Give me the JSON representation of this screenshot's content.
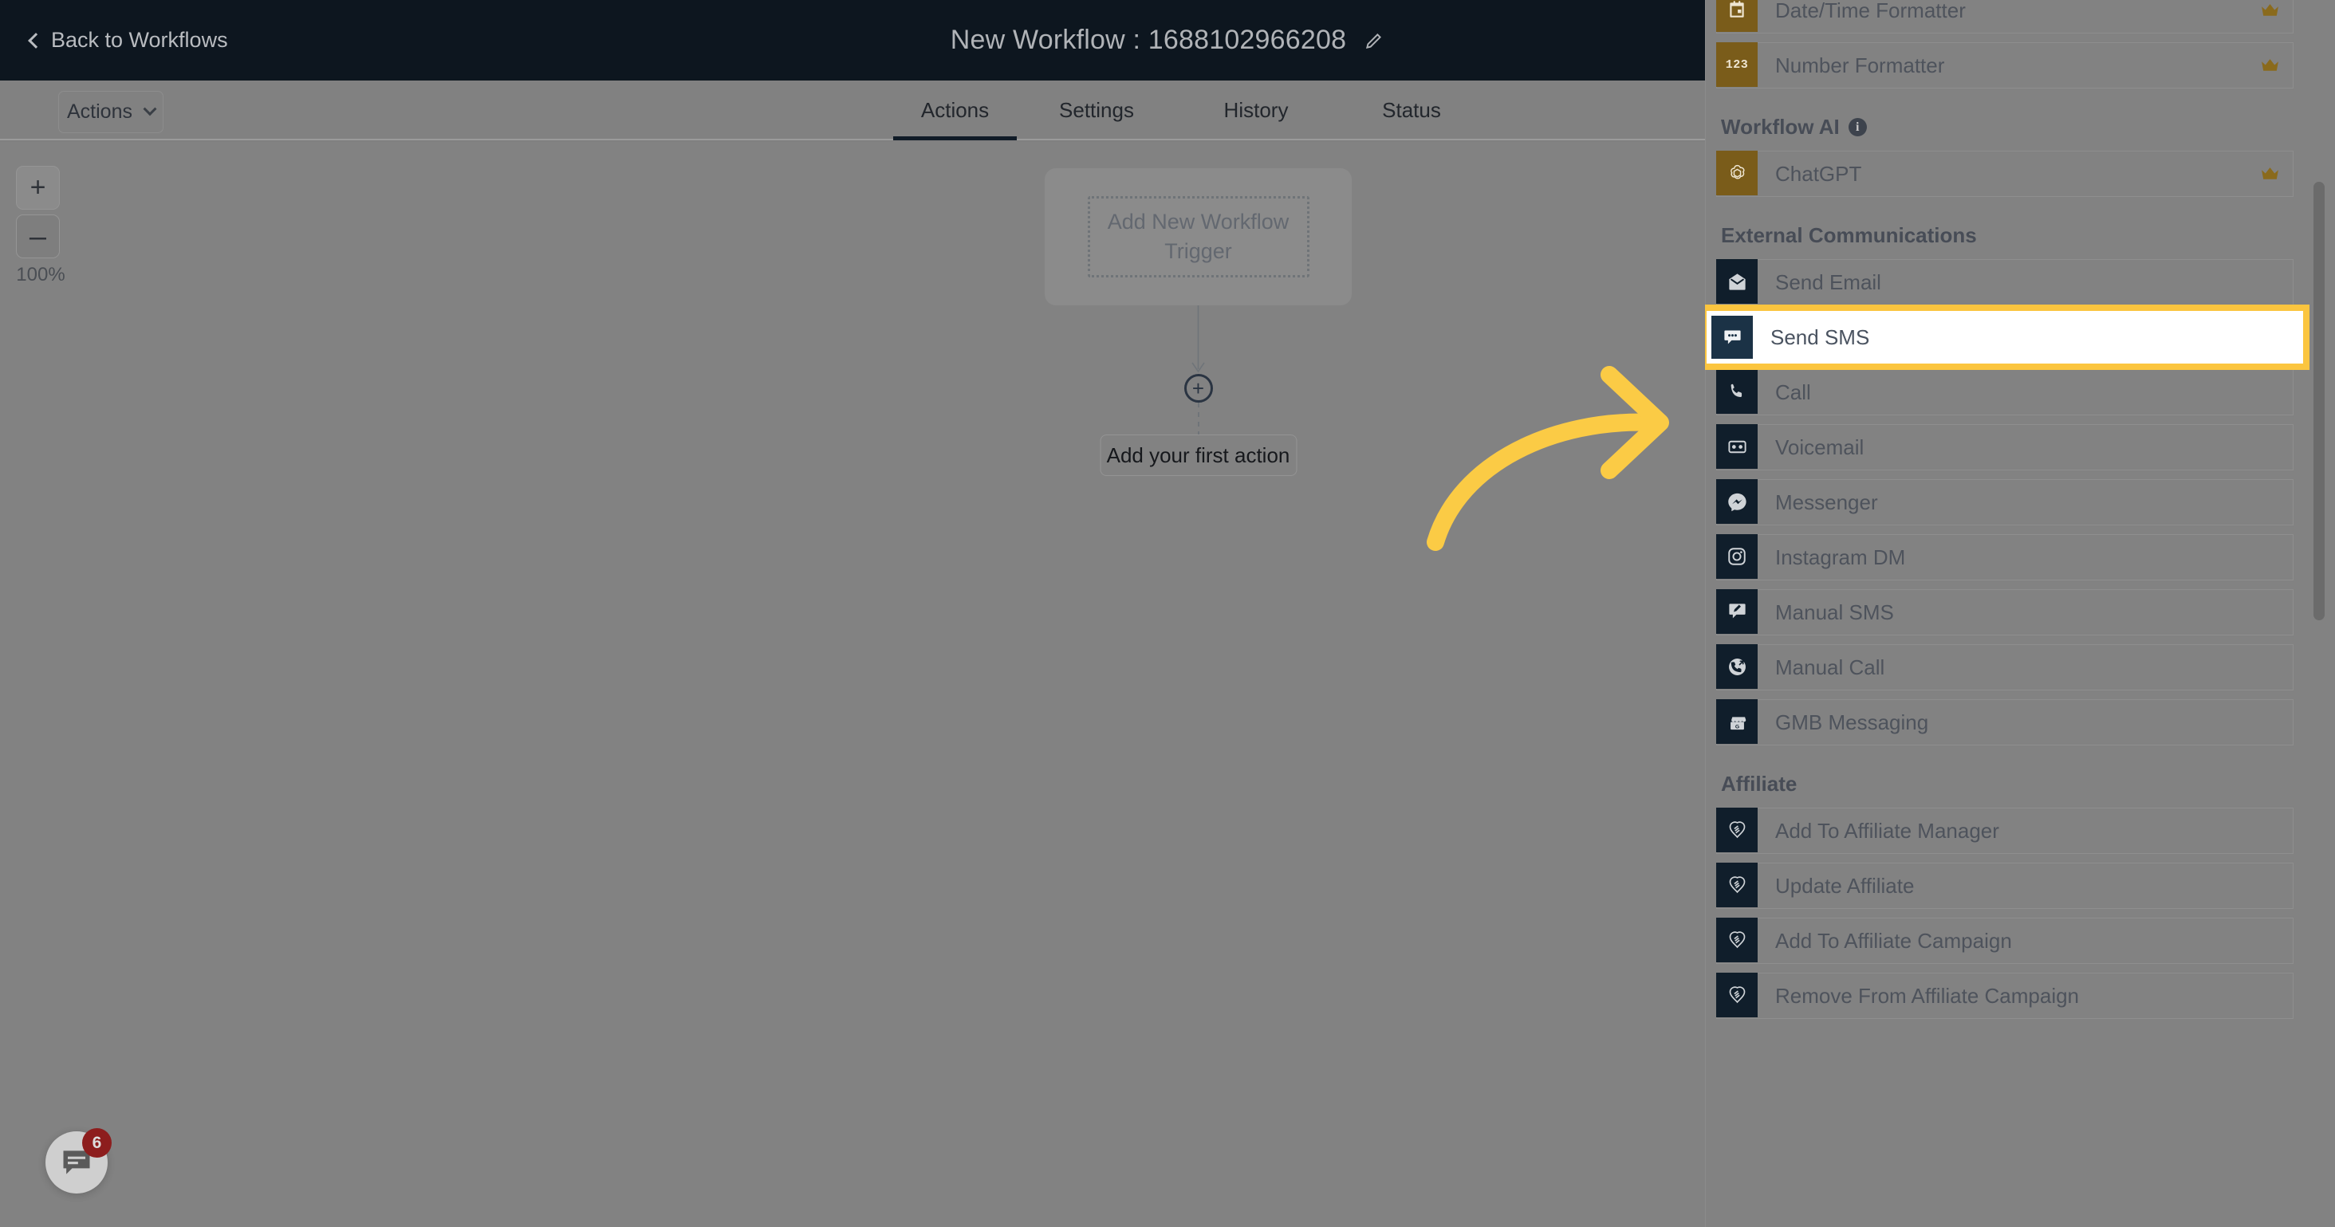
{
  "header": {
    "back_label": "Back to Workflows",
    "back_icon": "chevron-left-icon",
    "workflow_title": "New Workflow : 1688102966208",
    "edit_icon": "pencil-icon"
  },
  "toolbar": {
    "actions_button": "Actions",
    "actions_caret_icon": "chevron-down-icon"
  },
  "tabs": [
    {
      "label": "Actions",
      "active": true
    },
    {
      "label": "Settings",
      "active": false
    },
    {
      "label": "History",
      "active": false
    },
    {
      "label": "Status",
      "active": false
    }
  ],
  "canvas": {
    "zoom_in_label": "+",
    "zoom_out_label": "–",
    "zoom_level": "100%",
    "trigger_node_label": "Add New Workflow Trigger",
    "add_node_label": "+",
    "first_action_label": "Add your first action"
  },
  "chat_widget": {
    "icon": "chat-bubble-icon",
    "badge_count": "6"
  },
  "side_panel": {
    "groups": [
      {
        "title": null,
        "items": [
          {
            "label": "Date/Time Formatter",
            "icon": "calendar-icon",
            "icon_style": "gold",
            "premium": true
          },
          {
            "label": "Number Formatter",
            "icon": "numbers-123-icon",
            "icon_style": "gold",
            "premium": true
          }
        ]
      },
      {
        "title": "Workflow AI",
        "title_info_icon": "info-icon",
        "items": [
          {
            "label": "ChatGPT",
            "icon": "openai-icon",
            "icon_style": "gold",
            "premium": true
          }
        ]
      },
      {
        "title": "External Communications",
        "items": [
          {
            "label": "Send Email",
            "icon": "envelope-icon",
            "icon_style": "dark",
            "premium": false
          },
          {
            "label": "Send SMS",
            "icon": "sms-bubble-icon",
            "icon_style": "dark",
            "premium": false,
            "highlighted": true
          },
          {
            "label": "Call",
            "icon": "phone-icon",
            "icon_style": "dark",
            "premium": false
          },
          {
            "label": "Voicemail",
            "icon": "voicemail-tape-icon",
            "icon_style": "dark",
            "premium": false
          },
          {
            "label": "Messenger",
            "icon": "messenger-icon",
            "icon_style": "dark",
            "premium": false
          },
          {
            "label": "Instagram DM",
            "icon": "instagram-icon",
            "icon_style": "dark",
            "premium": false
          },
          {
            "label": "Manual SMS",
            "icon": "pencil-bubble-icon",
            "icon_style": "dark",
            "premium": false
          },
          {
            "label": "Manual Call",
            "icon": "phone-outgoing-icon",
            "icon_style": "dark",
            "premium": false
          },
          {
            "label": "GMB Messaging",
            "icon": "storefront-g-icon",
            "icon_style": "dark",
            "premium": false
          }
        ]
      },
      {
        "title": "Affiliate",
        "items": [
          {
            "label": "Add To Affiliate Manager",
            "icon": "handshake-icon",
            "icon_style": "dark",
            "premium": false
          },
          {
            "label": "Update Affiliate",
            "icon": "handshake-icon",
            "icon_style": "dark",
            "premium": false
          },
          {
            "label": "Add To Affiliate Campaign",
            "icon": "handshake-icon",
            "icon_style": "dark",
            "premium": false
          },
          {
            "label": "Remove From Affiliate Campaign",
            "icon": "handshake-icon",
            "icon_style": "dark",
            "premium": false
          }
        ]
      }
    ],
    "premium_icon": "crown-icon"
  },
  "annotation": {
    "arrow_icon": "curved-arrow-icon",
    "highlight_color": "#fbc53f",
    "arrow_color": "#fbcb45"
  },
  "theme": {
    "dark_header": "#0d161f",
    "dim_overlay": "#828282",
    "icon_dark": "#101e2b",
    "icon_gold": "#7a5c1a",
    "crown_gold": "#8a6a1c"
  }
}
